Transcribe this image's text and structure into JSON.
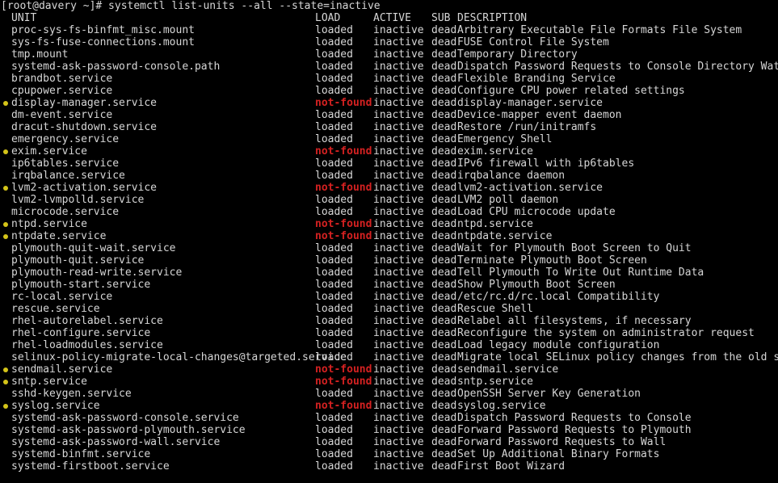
{
  "terminal": {
    "prompt": "[root@davery ~]# systemctl list-units --all --state=inactive",
    "colors": {
      "background": "#000000",
      "foreground": "#d6d6d6",
      "not_found": "#d42121",
      "bullet": "#d4c419"
    },
    "header": {
      "unit": "UNIT",
      "load": "LOAD",
      "active": "ACTIVE",
      "sub": "SUB",
      "description": "DESCRIPTION"
    },
    "rows": [
      {
        "bullet": false,
        "unit": "proc-sys-fs-binfmt_misc.mount",
        "load": "loaded",
        "active": "inactive",
        "sub": "dead",
        "description": "Arbitrary Executable File Formats File System"
      },
      {
        "bullet": false,
        "unit": "sys-fs-fuse-connections.mount",
        "load": "loaded",
        "active": "inactive",
        "sub": "dead",
        "description": "FUSE Control File System"
      },
      {
        "bullet": false,
        "unit": "tmp.mount",
        "load": "loaded",
        "active": "inactive",
        "sub": "dead",
        "description": "Temporary Directory"
      },
      {
        "bullet": false,
        "unit": "systemd-ask-password-console.path",
        "load": "loaded",
        "active": "inactive",
        "sub": "dead",
        "description": "Dispatch Password Requests to Console Directory Watch"
      },
      {
        "bullet": false,
        "unit": "brandbot.service",
        "load": "loaded",
        "active": "inactive",
        "sub": "dead",
        "description": "Flexible Branding Service"
      },
      {
        "bullet": false,
        "unit": "cpupower.service",
        "load": "loaded",
        "active": "inactive",
        "sub": "dead",
        "description": "Configure CPU power related settings"
      },
      {
        "bullet": true,
        "unit": "display-manager.service",
        "load": "not-found",
        "active": "inactive",
        "sub": "dead",
        "description": "display-manager.service"
      },
      {
        "bullet": false,
        "unit": "dm-event.service",
        "load": "loaded",
        "active": "inactive",
        "sub": "dead",
        "description": "Device-mapper event daemon"
      },
      {
        "bullet": false,
        "unit": "dracut-shutdown.service",
        "load": "loaded",
        "active": "inactive",
        "sub": "dead",
        "description": "Restore /run/initramfs"
      },
      {
        "bullet": false,
        "unit": "emergency.service",
        "load": "loaded",
        "active": "inactive",
        "sub": "dead",
        "description": "Emergency Shell"
      },
      {
        "bullet": true,
        "unit": "exim.service",
        "load": "not-found",
        "active": "inactive",
        "sub": "dead",
        "description": "exim.service"
      },
      {
        "bullet": false,
        "unit": "ip6tables.service",
        "load": "loaded",
        "active": "inactive",
        "sub": "dead",
        "description": "IPv6 firewall with ip6tables"
      },
      {
        "bullet": false,
        "unit": "irqbalance.service",
        "load": "loaded",
        "active": "inactive",
        "sub": "dead",
        "description": "irqbalance daemon"
      },
      {
        "bullet": true,
        "unit": "lvm2-activation.service",
        "load": "not-found",
        "active": "inactive",
        "sub": "dead",
        "description": "lvm2-activation.service"
      },
      {
        "bullet": false,
        "unit": "lvm2-lvmpolld.service",
        "load": "loaded",
        "active": "inactive",
        "sub": "dead",
        "description": "LVM2 poll daemon"
      },
      {
        "bullet": false,
        "unit": "microcode.service",
        "load": "loaded",
        "active": "inactive",
        "sub": "dead",
        "description": "Load CPU microcode update"
      },
      {
        "bullet": true,
        "unit": "ntpd.service",
        "load": "not-found",
        "active": "inactive",
        "sub": "dead",
        "description": "ntpd.service"
      },
      {
        "bullet": true,
        "unit": "ntpdate.service",
        "load": "not-found",
        "active": "inactive",
        "sub": "dead",
        "description": "ntpdate.service"
      },
      {
        "bullet": false,
        "unit": "plymouth-quit-wait.service",
        "load": "loaded",
        "active": "inactive",
        "sub": "dead",
        "description": "Wait for Plymouth Boot Screen to Quit"
      },
      {
        "bullet": false,
        "unit": "plymouth-quit.service",
        "load": "loaded",
        "active": "inactive",
        "sub": "dead",
        "description": "Terminate Plymouth Boot Screen"
      },
      {
        "bullet": false,
        "unit": "plymouth-read-write.service",
        "load": "loaded",
        "active": "inactive",
        "sub": "dead",
        "description": "Tell Plymouth To Write Out Runtime Data"
      },
      {
        "bullet": false,
        "unit": "plymouth-start.service",
        "load": "loaded",
        "active": "inactive",
        "sub": "dead",
        "description": "Show Plymouth Boot Screen"
      },
      {
        "bullet": false,
        "unit": "rc-local.service",
        "load": "loaded",
        "active": "inactive",
        "sub": "dead",
        "description": "/etc/rc.d/rc.local Compatibility"
      },
      {
        "bullet": false,
        "unit": "rescue.service",
        "load": "loaded",
        "active": "inactive",
        "sub": "dead",
        "description": "Rescue Shell"
      },
      {
        "bullet": false,
        "unit": "rhel-autorelabel.service",
        "load": "loaded",
        "active": "inactive",
        "sub": "dead",
        "description": "Relabel all filesystems, if necessary"
      },
      {
        "bullet": false,
        "unit": "rhel-configure.service",
        "load": "loaded",
        "active": "inactive",
        "sub": "dead",
        "description": "Reconfigure the system on administrator request"
      },
      {
        "bullet": false,
        "unit": "rhel-loadmodules.service",
        "load": "loaded",
        "active": "inactive",
        "sub": "dead",
        "description": "Load legacy module configuration"
      },
      {
        "bullet": false,
        "unit": "selinux-policy-migrate-local-changes@targeted.service",
        "load": "loaded",
        "active": "inactive",
        "sub": "dead",
        "description": "Migrate local SELinux policy changes from the old store s"
      },
      {
        "bullet": true,
        "unit": "sendmail.service",
        "load": "not-found",
        "active": "inactive",
        "sub": "dead",
        "description": "sendmail.service"
      },
      {
        "bullet": true,
        "unit": "sntp.service",
        "load": "not-found",
        "active": "inactive",
        "sub": "dead",
        "description": "sntp.service"
      },
      {
        "bullet": false,
        "unit": "sshd-keygen.service",
        "load": "loaded",
        "active": "inactive",
        "sub": "dead",
        "description": "OpenSSH Server Key Generation"
      },
      {
        "bullet": true,
        "unit": "syslog.service",
        "load": "not-found",
        "active": "inactive",
        "sub": "dead",
        "description": "syslog.service"
      },
      {
        "bullet": false,
        "unit": "systemd-ask-password-console.service",
        "load": "loaded",
        "active": "inactive",
        "sub": "dead",
        "description": "Dispatch Password Requests to Console"
      },
      {
        "bullet": false,
        "unit": "systemd-ask-password-plymouth.service",
        "load": "loaded",
        "active": "inactive",
        "sub": "dead",
        "description": "Forward Password Requests to Plymouth"
      },
      {
        "bullet": false,
        "unit": "systemd-ask-password-wall.service",
        "load": "loaded",
        "active": "inactive",
        "sub": "dead",
        "description": "Forward Password Requests to Wall"
      },
      {
        "bullet": false,
        "unit": "systemd-binfmt.service",
        "load": "loaded",
        "active": "inactive",
        "sub": "dead",
        "description": "Set Up Additional Binary Formats"
      },
      {
        "bullet": false,
        "unit": "systemd-firstboot.service",
        "load": "loaded",
        "active": "inactive",
        "sub": "dead",
        "description": "First Boot Wizard"
      }
    ]
  }
}
